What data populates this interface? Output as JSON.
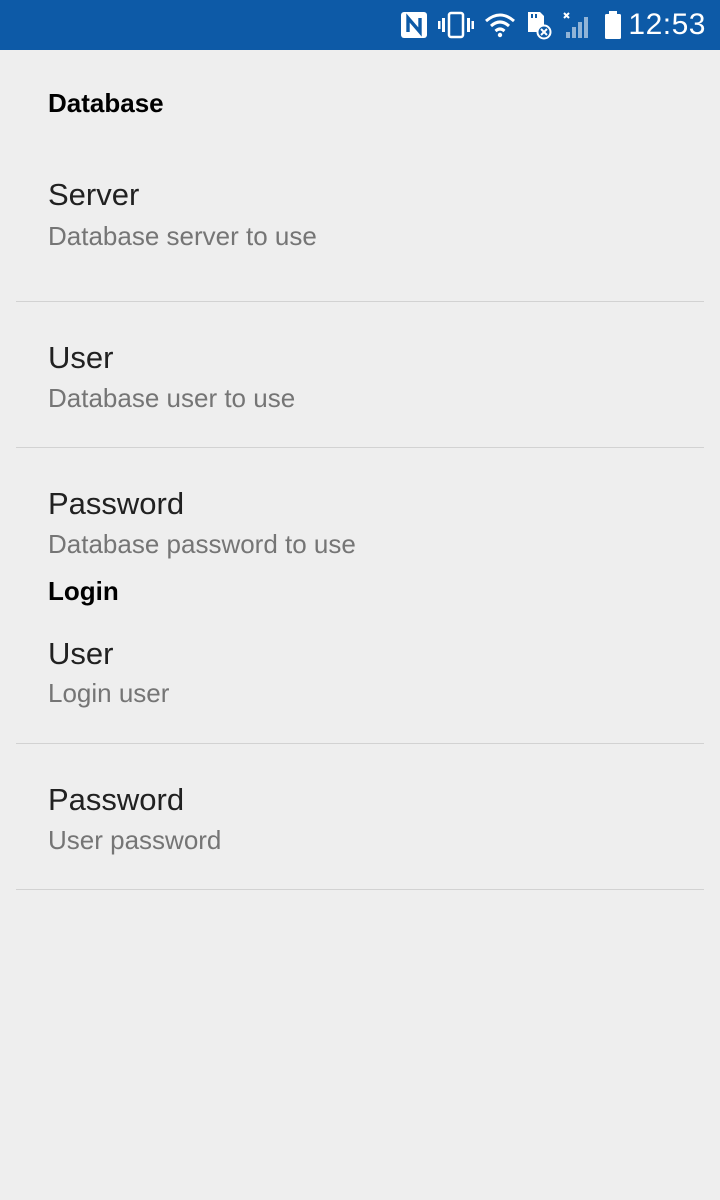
{
  "status_bar": {
    "time": "12:53",
    "icons": [
      "nfc-icon",
      "vibrate-icon",
      "wifi-icon",
      "sd-card-error-icon",
      "signal-no-service-icon",
      "battery-icon"
    ],
    "color": "#0d5aa7"
  },
  "preferences": {
    "database": {
      "title": "Database",
      "items": [
        {
          "title": "Server",
          "summary": "Database server to use"
        },
        {
          "title": "User",
          "summary": "Database user to use"
        },
        {
          "title": "Password",
          "summary": "Database password to use"
        }
      ]
    },
    "login": {
      "title": "Login",
      "items": [
        {
          "title": "User",
          "summary": "Login user"
        },
        {
          "title": "Password",
          "summary": "User password"
        }
      ]
    }
  }
}
